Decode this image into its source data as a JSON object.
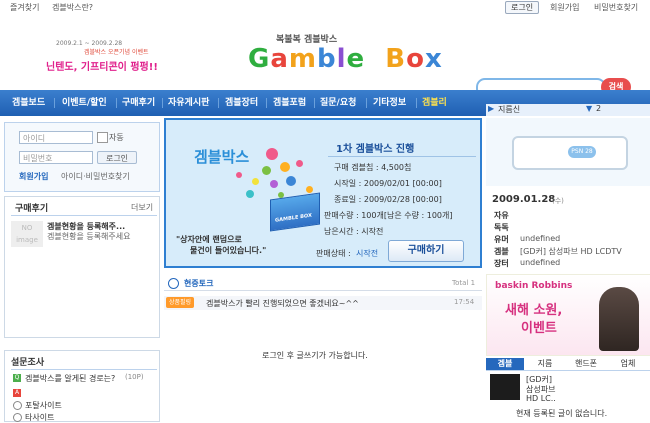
{
  "topbar": {
    "favorites": "즐겨찾기",
    "about": "겜블박스란?",
    "login": "로그인",
    "signup": "회원가입",
    "find_pw": "비밀번호찾기"
  },
  "header": {
    "event_line1": "2009.2.1 ~ 2009.2.28",
    "event_line2": "겜블박스 오픈기념 이벤트",
    "event_line3": "닌텐도, 기프티콘이 펑펑!!",
    "logo_sub": "복불복 겜블박스",
    "logo": "Gamble Box",
    "search_button": "검색"
  },
  "nav": {
    "items": [
      "겜블보드",
      "이벤트/할인",
      "구매후기",
      "자유게시판",
      "겜블장터",
      "겜블포럼",
      "질문/요청",
      "기타정보",
      "겜블리"
    ],
    "ticker_label": "지름신",
    "ticker_value": "2"
  },
  "login_box": {
    "id_placeholder": "아이디",
    "auto_label": "자동",
    "pw_placeholder": "비밀번호",
    "login_button": "로그인",
    "signup_link": "회원가입",
    "find_link": "아이디·비밀번호찾기"
  },
  "reviews": {
    "title": "구매후기",
    "more": "더보기",
    "no_image": "NO image",
    "line1": "겜블현황을 등록해주...",
    "line2": "겜블현황을 등록해주세요"
  },
  "poll": {
    "title": "설문조사",
    "question": "겜블박스를 알게된 경로는?",
    "question_count": "(10P)",
    "option1": "포탈사이트",
    "option2": "타사이트"
  },
  "banner": {
    "brand": "겜블박스",
    "round_title": "1차 겜블박스 진행",
    "price": "구매 겜블칩 : 4,500칩",
    "start": "시작일 : 2009/02/01 [00:00]",
    "end": "종료일 : 2009/02/28 [00:00]",
    "quantity": "판매수량 : 100개[남은 수량 : 100개]",
    "remaining_time": "남은시간 : 시작전",
    "status_label": "판매상태 :",
    "status_value": "시작전",
    "buy_button": "구매하기",
    "slogan1": "\"상자안에 랜덤으로",
    "slogan2": "물건이 들어있습니다.\"",
    "box_label": "GAMBLE BOX"
  },
  "talk": {
    "title": "현중토크",
    "total": "Total 1",
    "badge": "상품필링",
    "message": "겜블박스가 빨리 진행되었으면 좋겠네요~^^",
    "time": "17:54",
    "login_notice": "로그인 후 글쓰기가 가능합니다."
  },
  "right": {
    "device_label": "PSN 28",
    "date": "2009.01.28",
    "weekday": "(수)",
    "rows": [
      {
        "label": "자유",
        "value": ""
      },
      {
        "label": "독독",
        "value": ""
      },
      {
        "label": "유머",
        "value": "undefined"
      },
      {
        "label": "겜블",
        "value": "[GD커] 삼성파브 HD LCDTV"
      },
      {
        "label": "장터",
        "value": "undefined"
      }
    ],
    "ad_brand": "baskin Robbins",
    "ad_line1": "새해 소원,",
    "ad_line2": "이벤트",
    "tabs": [
      "겜블",
      "지름",
      "핸드폰",
      "업체"
    ],
    "product_line1": "[GD커]",
    "product_line2": "삼성파브",
    "product_line3": "HD LC..",
    "empty_notice": "현재 등록된 글이 없습니다."
  },
  "colors": {
    "nav_blue": "#2568bd",
    "accent_pink": "#e0208c",
    "search_red": "#e84d4d",
    "banner_border": "#2f7fd1"
  }
}
